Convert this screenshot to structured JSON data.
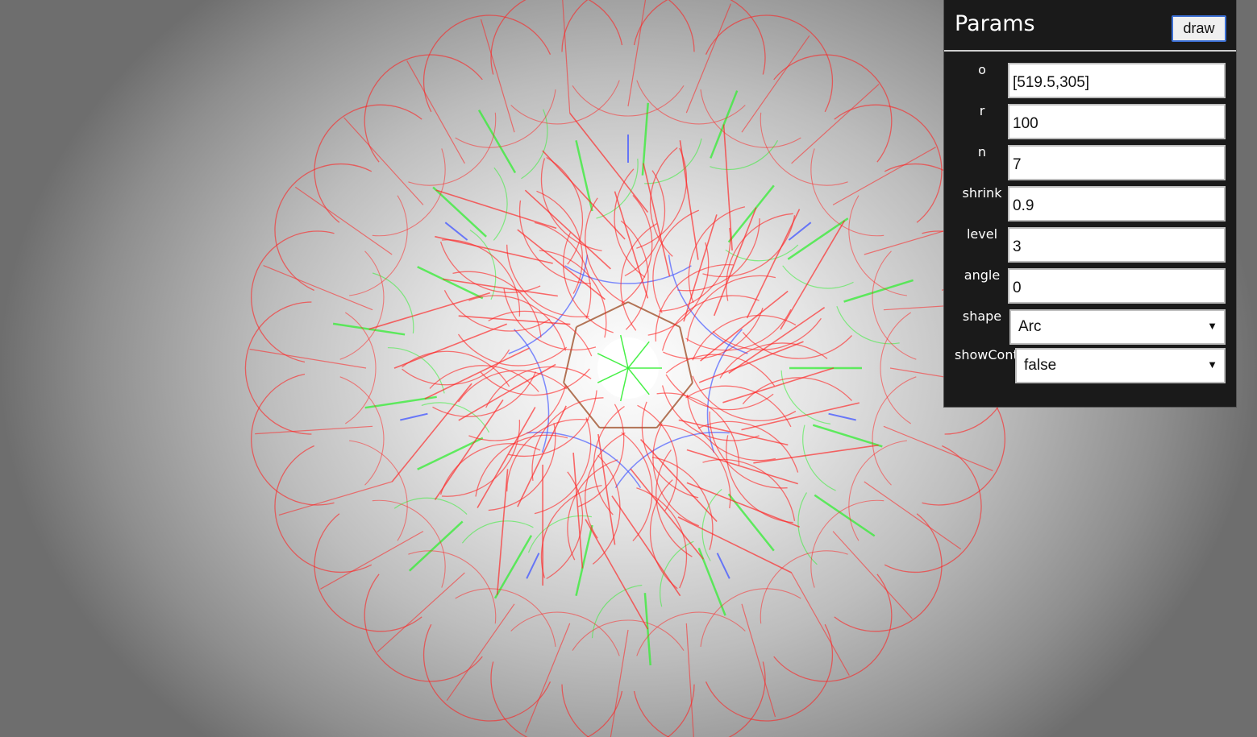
{
  "canvas": {
    "background": "#ffffff",
    "colors": {
      "level_outer": "#ff2020",
      "level_inner": "#33ee33",
      "level_core": "#4a5cff",
      "center_fill": "#ffffff"
    }
  },
  "panel": {
    "title": "Params",
    "draw_label": "draw",
    "fields": [
      {
        "label": "o",
        "value": "[519.5,305]"
      },
      {
        "label": "r",
        "value": "100"
      },
      {
        "label": "n",
        "value": "7"
      },
      {
        "label": "shrink",
        "value": "0.9"
      },
      {
        "label": "level",
        "value": "3"
      },
      {
        "label": "angle",
        "value": "0"
      }
    ],
    "shape": {
      "label": "shape",
      "value": "Arc",
      "arrow_icon": "dropdown-arrow"
    },
    "showcont": {
      "label": "showCont",
      "value": "false",
      "arrow_icon": "dropdown-arrow"
    }
  }
}
